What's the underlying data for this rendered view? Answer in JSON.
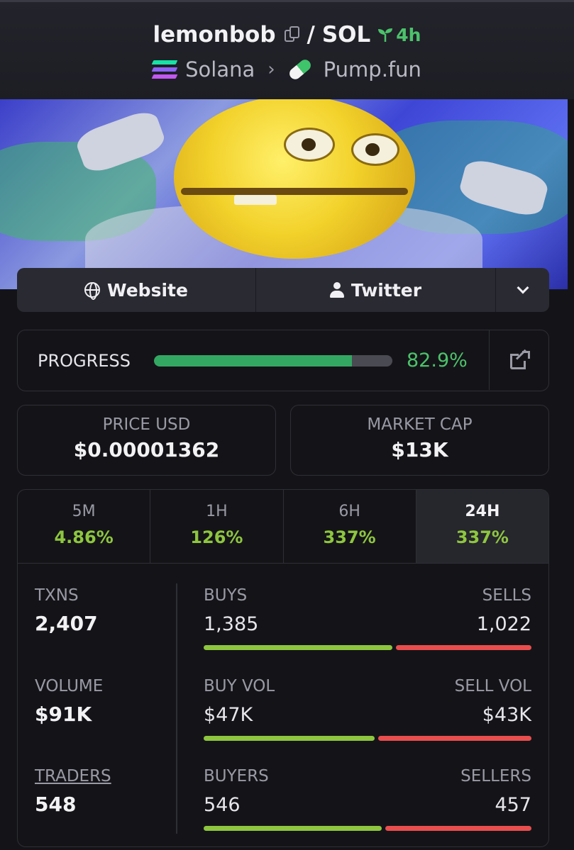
{
  "header": {
    "token_name": "lemonbob",
    "separator": "/",
    "pair": "SOL",
    "age": "4h",
    "chain": "Solana",
    "launchpad": "Pump.fun"
  },
  "links": {
    "website": "Website",
    "twitter": "Twitter"
  },
  "progress": {
    "label": "PROGRESS",
    "value": "82.9%",
    "fraction": 0.829
  },
  "price_usd": {
    "label": "PRICE USD",
    "value": "$0.00001362"
  },
  "market_cap": {
    "label": "MARKET CAP",
    "value": "$13K"
  },
  "timeframes": [
    {
      "label": "5M",
      "change": "4.86%"
    },
    {
      "label": "1H",
      "change": "126%"
    },
    {
      "label": "6H",
      "change": "337%"
    },
    {
      "label": "24H",
      "change": "337%"
    }
  ],
  "stats": {
    "txns": {
      "label": "TXNS",
      "value": "2,407"
    },
    "volume": {
      "label": "VOLUME",
      "value": "$91K"
    },
    "traders": {
      "label": "TRADERS",
      "value": "548"
    },
    "buys": {
      "label": "BUYS",
      "value": "1,385"
    },
    "sells": {
      "label": "SELLS",
      "value": "1,022"
    },
    "buys_ratio": 0.575,
    "buy_vol": {
      "label": "BUY VOL",
      "value": "$47K"
    },
    "sell_vol": {
      "label": "SELL VOL",
      "value": "$43K"
    },
    "buy_vol_ratio": 0.522,
    "buyers": {
      "label": "BUYERS",
      "value": "546"
    },
    "sellers": {
      "label": "SELLERS",
      "value": "457"
    },
    "buyers_ratio": 0.544
  },
  "colors": {
    "positive": "#8ec63f",
    "progress": "#33a862",
    "sell": "#e94e4e"
  }
}
